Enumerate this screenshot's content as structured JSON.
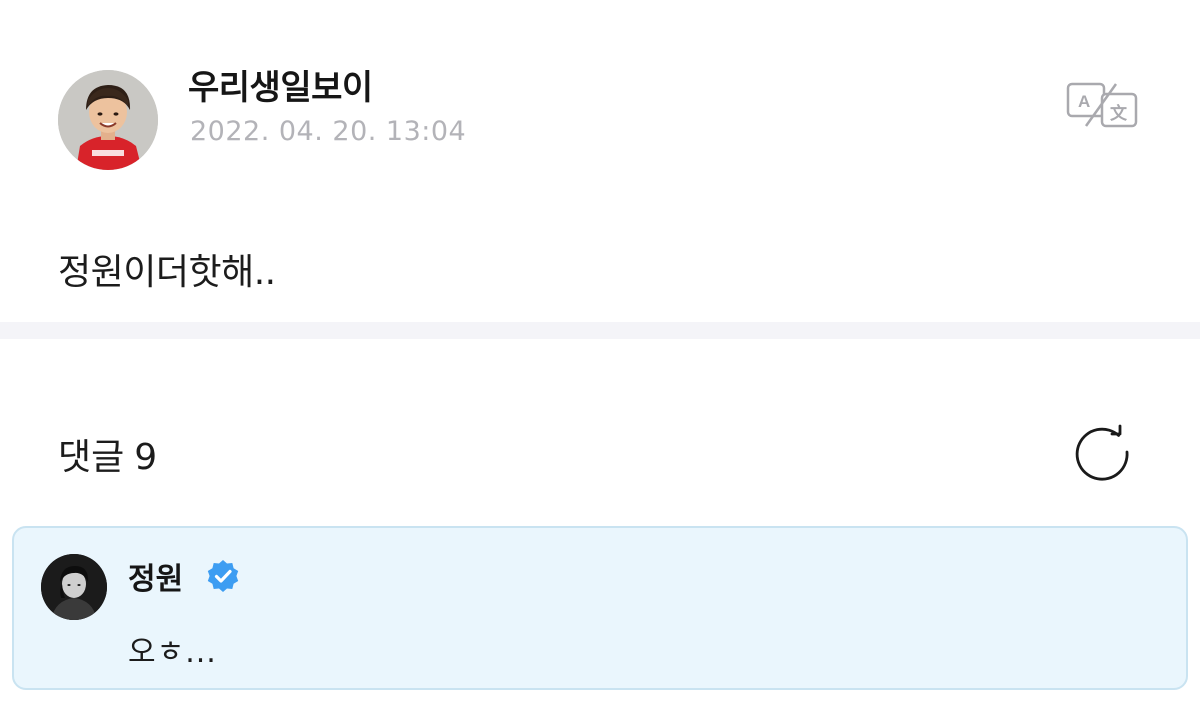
{
  "post": {
    "author": "우리생일보이",
    "date": "2022. 04. 20. 13:04",
    "body": "정원이더핫해..",
    "avatar_icon": "child-profile-photo",
    "translate_icon": "translate-icon"
  },
  "comments": {
    "label": "댓글",
    "count": "9",
    "refresh_icon": "refresh-icon",
    "items": [
      {
        "author": "정원",
        "verified": true,
        "text": "오ㅎ...",
        "highlighted": true
      }
    ]
  },
  "colors": {
    "date_gray": "#b3b3b8",
    "divider": "#f4f4f8",
    "comment_bg": "#eaf6fd",
    "comment_border": "#c9e3f1",
    "verified_blue": "#3d9df2"
  }
}
